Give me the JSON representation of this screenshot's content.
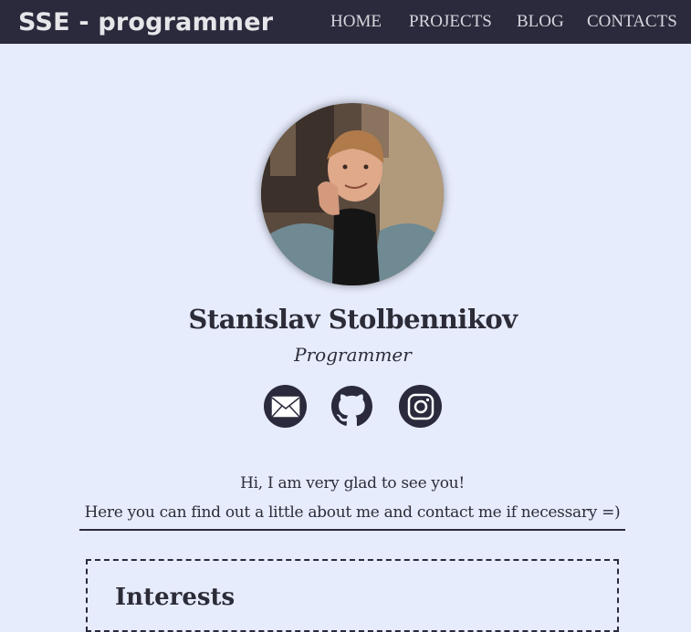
{
  "nav": {
    "brand": "SSE - programmer",
    "items": [
      {
        "label": "HOME"
      },
      {
        "label": "PROJECTS"
      },
      {
        "label": "BLOG"
      },
      {
        "label": "CONTACTS"
      }
    ]
  },
  "profile": {
    "name": "Stanislav Stolbennikov",
    "role": "Programmer",
    "avatar_icon": "profile-photo"
  },
  "social": [
    {
      "icon": "mail-icon"
    },
    {
      "icon": "github-icon"
    },
    {
      "icon": "instagram-icon"
    }
  ],
  "greeting": {
    "line1": "Hi, I am very glad to see you!",
    "line2": "Here you can find out a little about me and contact me if necessary =)"
  },
  "interests": {
    "title": "Interests"
  },
  "colors": {
    "background": "#e7ecfd",
    "navbar": "#2a2a3c",
    "text": "#2c2c38",
    "nav_text": "#d6d6de"
  }
}
